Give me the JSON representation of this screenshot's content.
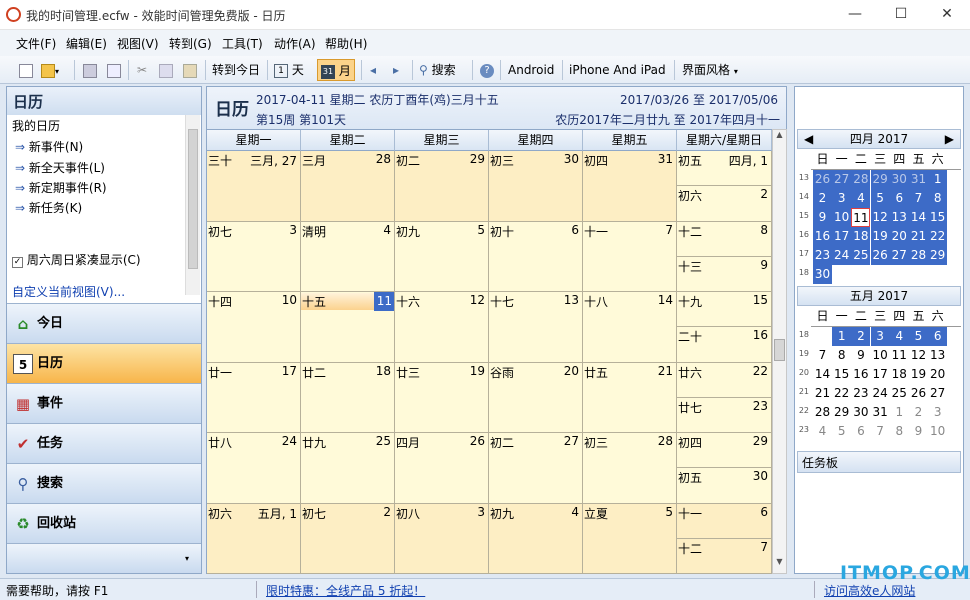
{
  "window": {
    "title": "我的时间管理.ecfw - 效能时间管理免费版 - 日历",
    "minimize": "—",
    "maximize": "☐",
    "close": "✕"
  },
  "menu": [
    "文件(F)",
    "编辑(E)",
    "视图(V)",
    "转到(G)",
    "工具(T)",
    "动作(A)",
    "帮助(H)"
  ],
  "toolbar": {
    "goto_today": "转到今日",
    "day": "天",
    "day_icon": "1",
    "month": "月",
    "month_icon": "31",
    "search": "搜索",
    "android": "Android",
    "iphone": "iPhone And iPad",
    "skin": "界面风格"
  },
  "left": {
    "title": "日历",
    "my_calendar": "我的日历",
    "actions": [
      "新事件(N)",
      "新全天事件(L)",
      "新定期事件(R)",
      "新任务(K)"
    ],
    "weekend_checkbox": "周六周日紧凑显示(C)",
    "custom_view": "自定义当前视图(V)...",
    "nav": [
      "今日",
      "日历",
      "事件",
      "任务",
      "搜索",
      "回收站"
    ],
    "nav_icons": [
      "⌂",
      "5",
      "▦",
      "✔",
      "⚲",
      "♻"
    ]
  },
  "calendar": {
    "title": "日历",
    "date_line": "2017-04-11 星期二 农历丁酉年(鸡)三月十五",
    "week_line": "第15周 第101天",
    "range": "2017/03/26 至 2017/05/06",
    "lunar_range": "农历2017年二月廿九 至 2017年四月十一",
    "headers": [
      "星期一",
      "星期二",
      "星期三",
      "星期四",
      "星期五",
      "星期六/星期日"
    ],
    "weeks": [
      {
        "days": [
          [
            "三十",
            "三月, 27"
          ],
          [
            "三月",
            "28"
          ],
          [
            "初二",
            "29"
          ],
          [
            "初三",
            "30"
          ],
          [
            "初四",
            "31"
          ]
        ],
        "sat": [
          "初五",
          "四月, 1"
        ],
        "sun": [
          "初六",
          "2"
        ]
      },
      {
        "days": [
          [
            "初七",
            "3"
          ],
          [
            "清明",
            "4"
          ],
          [
            "初九",
            "5"
          ],
          [
            "初十",
            "6"
          ],
          [
            "十一",
            "7"
          ]
        ],
        "sat": [
          "十二",
          "8"
        ],
        "sun": [
          "十三",
          "9"
        ]
      },
      {
        "days": [
          [
            "十四",
            "10"
          ],
          [
            "十五",
            "11"
          ],
          [
            "十六",
            "12"
          ],
          [
            "十七",
            "13"
          ],
          [
            "十八",
            "14"
          ]
        ],
        "sat": [
          "十九",
          "15"
        ],
        "sun": [
          "二十",
          "16"
        ]
      },
      {
        "days": [
          [
            "廿一",
            "17"
          ],
          [
            "廿二",
            "18"
          ],
          [
            "廿三",
            "19"
          ],
          [
            "谷雨",
            "20"
          ],
          [
            "廿五",
            "21"
          ]
        ],
        "sat": [
          "廿六",
          "22"
        ],
        "sun": [
          "廿七",
          "23"
        ]
      },
      {
        "days": [
          [
            "廿八",
            "24"
          ],
          [
            "廿九",
            "25"
          ],
          [
            "四月",
            "26"
          ],
          [
            "初二",
            "27"
          ],
          [
            "初三",
            "28"
          ]
        ],
        "sat": [
          "初四",
          "29"
        ],
        "sun": [
          "初五",
          "30"
        ]
      },
      {
        "days": [
          [
            "初六",
            "五月, 1"
          ],
          [
            "初七",
            "2"
          ],
          [
            "初八",
            "3"
          ],
          [
            "初九",
            "4"
          ],
          [
            "立夏",
            "5"
          ]
        ],
        "sat": [
          "十一",
          "6"
        ],
        "sun": [
          "十二",
          "7"
        ]
      }
    ]
  },
  "mini_april": {
    "title": "四月 2017",
    "weekdays": [
      "日",
      "一",
      "二",
      "三",
      "四",
      "五",
      "六"
    ],
    "weeks": [
      "13",
      "14",
      "15",
      "16",
      "17",
      "18"
    ],
    "days": [
      [
        "26",
        "27",
        "28",
        "29",
        "30",
        "31",
        "1"
      ],
      [
        "2",
        "3",
        "4",
        "5",
        "6",
        "7",
        "8"
      ],
      [
        "9",
        "10",
        "11",
        "12",
        "13",
        "14",
        "15"
      ],
      [
        "16",
        "17",
        "18",
        "19",
        "20",
        "21",
        "22"
      ],
      [
        "23",
        "24",
        "25",
        "26",
        "27",
        "28",
        "29"
      ],
      [
        "30",
        "",
        "",
        "",
        "",
        "",
        ""
      ]
    ]
  },
  "mini_may": {
    "title": "五月 2017",
    "weekdays": [
      "日",
      "一",
      "二",
      "三",
      "四",
      "五",
      "六"
    ],
    "weeks": [
      "18",
      "19",
      "20",
      "21",
      "22",
      "23"
    ],
    "days": [
      [
        "",
        "1",
        "2",
        "3",
        "4",
        "5",
        "6"
      ],
      [
        "7",
        "8",
        "9",
        "10",
        "11",
        "12",
        "13"
      ],
      [
        "14",
        "15",
        "16",
        "17",
        "18",
        "19",
        "20"
      ],
      [
        "21",
        "22",
        "23",
        "24",
        "25",
        "26",
        "27"
      ],
      [
        "28",
        "29",
        "30",
        "31",
        "1",
        "2",
        "3"
      ],
      [
        "4",
        "5",
        "6",
        "7",
        "8",
        "9",
        "10"
      ]
    ]
  },
  "taskboard": "任务板",
  "status": {
    "help": "需要帮助，请按 F1",
    "promo": "限时特惠：全线产品 5 折起！",
    "visit": "访问高效e人网站"
  },
  "watermark": "ITMOP.COM",
  "colors": {
    "accent": "#3d6bc7",
    "cell": "#fffad9",
    "cell_other_month": "#fdeec4",
    "nav_active": "#f7b54a"
  }
}
